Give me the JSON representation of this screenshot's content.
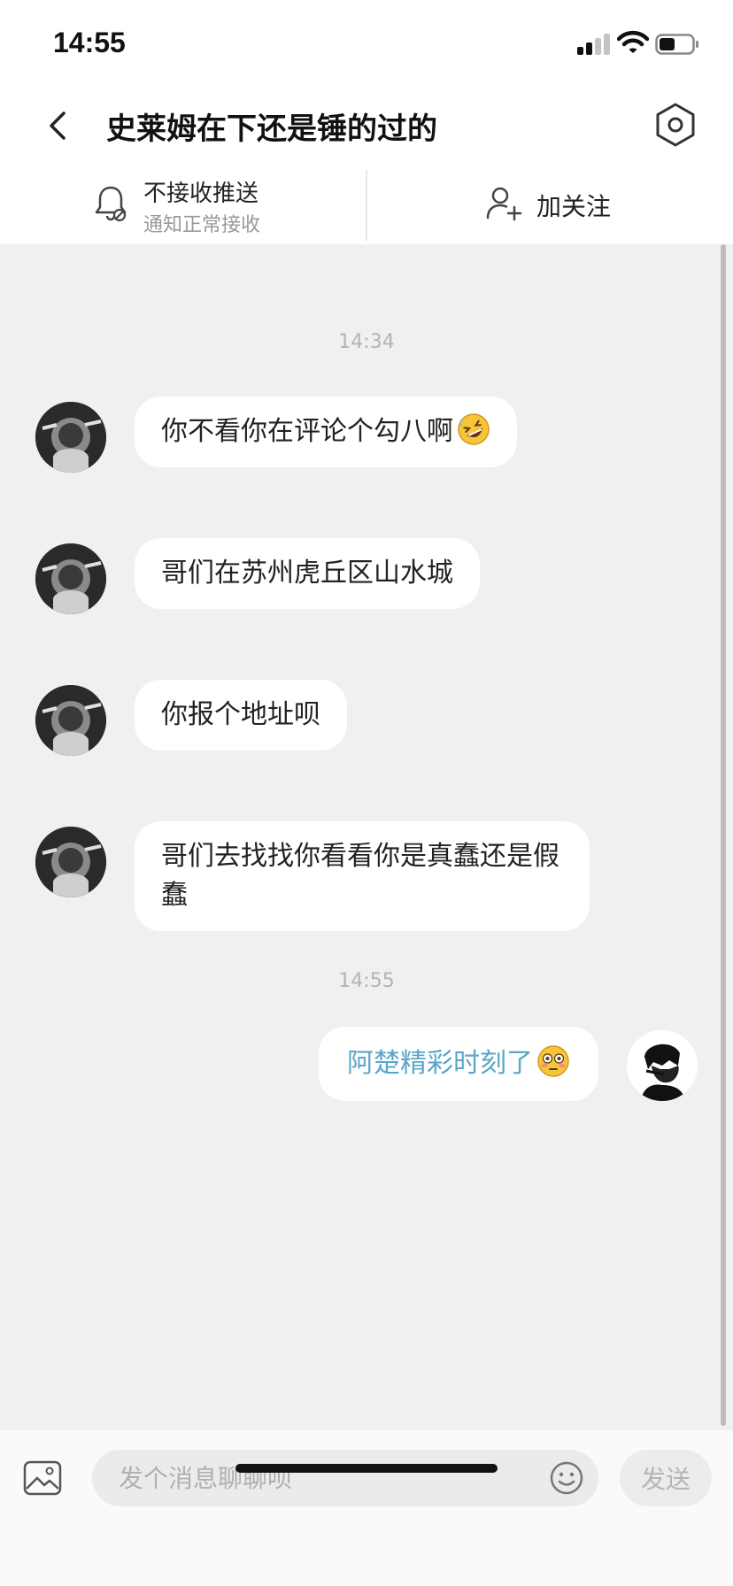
{
  "status_bar": {
    "time": "14:55"
  },
  "header": {
    "title": "史莱姆在下还是锤的过的"
  },
  "actions": {
    "push_label": "不接收推送",
    "push_sub": "通知正常接收",
    "follow_label": "加关注"
  },
  "messages": [
    {
      "type": "time",
      "text": "14:34"
    },
    {
      "type": "in",
      "text": "你不看你在评论个勾八啊",
      "emoji": "rolling-on-floor-laughing-emoji"
    },
    {
      "type": "in",
      "text": "哥们在苏州虎丘区山水城"
    },
    {
      "type": "in",
      "text": "你报个地址呗"
    },
    {
      "type": "in",
      "text": "哥们去找找你看看你是真蠢还是假蠢"
    },
    {
      "type": "time",
      "text": "14:55"
    },
    {
      "type": "out",
      "text": "阿楚精彩时刻了",
      "emoji": "flushed-face-emoji"
    }
  ],
  "composer": {
    "placeholder": "发个消息聊聊呗",
    "send_label": "发送"
  },
  "colors": {
    "chat_background": "#f0f0f0",
    "outgoing_text": "#5aa6c8",
    "incoming_text": "#222222"
  }
}
